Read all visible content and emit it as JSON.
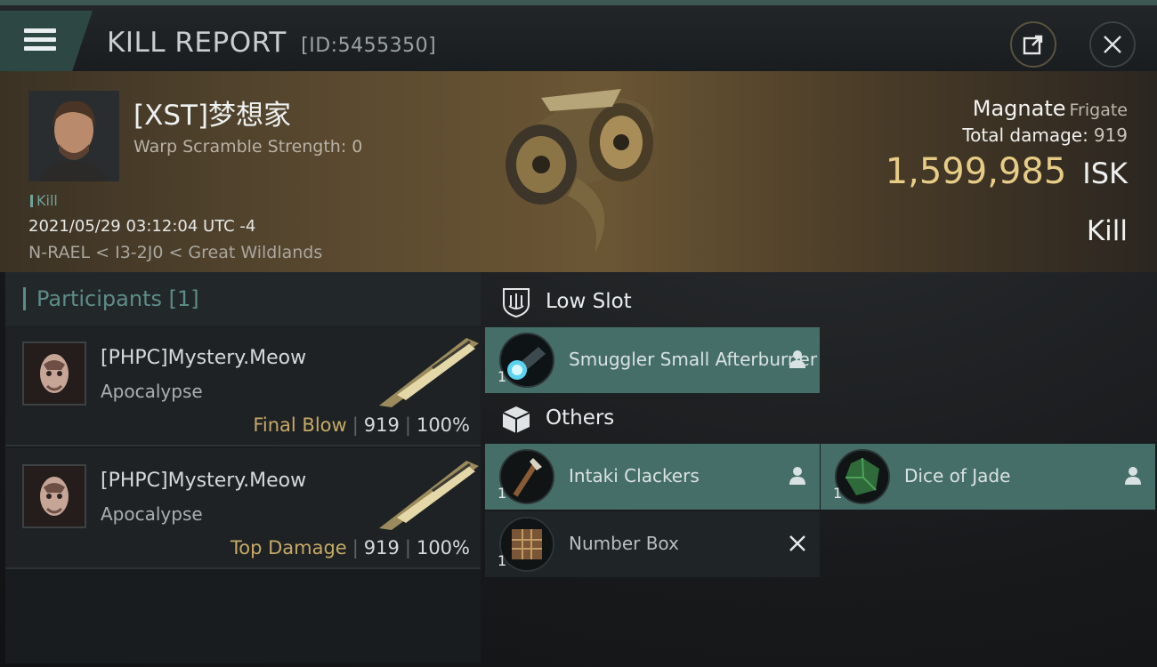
{
  "header": {
    "title": "KILL REPORT",
    "report_id": "[ID:5455350]"
  },
  "victim": {
    "name": "[XST]梦想家",
    "warp_scramble": "Warp Scramble Strength: 0",
    "tag": "Kill",
    "datetime": "2021/05/29 03:12:04 UTC -4",
    "location": "N-RAEL < I3-2J0 < Great Wildlands",
    "ship_name": "Magnate",
    "ship_class": "Frigate",
    "total_damage_label": "Total damage:",
    "total_damage": "919",
    "isk_value": "1,599,985",
    "isk_unit": "ISK",
    "result": "Kill"
  },
  "participants": {
    "title": "Participants [1]",
    "rows": [
      {
        "name": "[PHPC]Mystery.Meow",
        "ship": "Apocalypse",
        "label": "Final Blow",
        "damage": "919",
        "percent": "100%"
      },
      {
        "name": "[PHPC]Mystery.Meow",
        "ship": "Apocalypse",
        "label": "Top Damage",
        "damage": "919",
        "percent": "100%"
      }
    ]
  },
  "sections": {
    "low_slot": "Low Slot",
    "others": "Others"
  },
  "items": {
    "afterburner": {
      "qty": "1",
      "name": "Smuggler Small Afterburner",
      "status": "dropped"
    },
    "clackers": {
      "qty": "1",
      "name": "Intaki Clackers",
      "status": "dropped"
    },
    "dice": {
      "qty": "1",
      "name": "Dice of Jade",
      "status": "dropped"
    },
    "number_box": {
      "qty": "1",
      "name": "Number Box",
      "status": "destroyed"
    }
  },
  "colors": {
    "accent_teal": "#466e69",
    "gold": "#e7cc86",
    "final_blow": "#c6aa66"
  }
}
